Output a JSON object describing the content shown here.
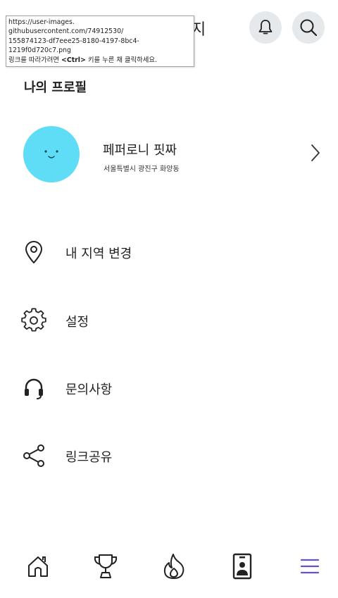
{
  "header": {
    "title_fragment": "지",
    "notification_icon": "bell-icon",
    "search_icon": "search-icon"
  },
  "tooltip": {
    "line1": "https://user-images.",
    "line2": "githubusercontent.com/74912530/",
    "line3": "155874123-df7eee25-8180-4197-8bc4-",
    "line4": "1219f0d720c7.png",
    "line5_prefix": "링크를 따라가려면 ",
    "line5_key": "<Ctrl>",
    "line5_suffix": " 키를 누른 채 클릭하세요."
  },
  "profile": {
    "section_title": "나의 프로필",
    "name": "페퍼로니 핏짜",
    "location": "서울특별시 광진구 화양동",
    "avatar_color": "#5fdcf6"
  },
  "menu": {
    "items": [
      {
        "label": "내 지역 변경",
        "icon": "location-pin-icon"
      },
      {
        "label": "설정",
        "icon": "gear-icon"
      },
      {
        "label": "문의사항",
        "icon": "headset-icon"
      },
      {
        "label": "링크공유",
        "icon": "share-icon"
      }
    ]
  },
  "bottom_nav": {
    "items": [
      {
        "icon": "home-icon"
      },
      {
        "icon": "trophy-icon"
      },
      {
        "icon": "flame-icon"
      },
      {
        "icon": "id-card-icon"
      },
      {
        "icon": "menu-icon",
        "active": true
      }
    ],
    "active_color": "#6a4fc8"
  }
}
